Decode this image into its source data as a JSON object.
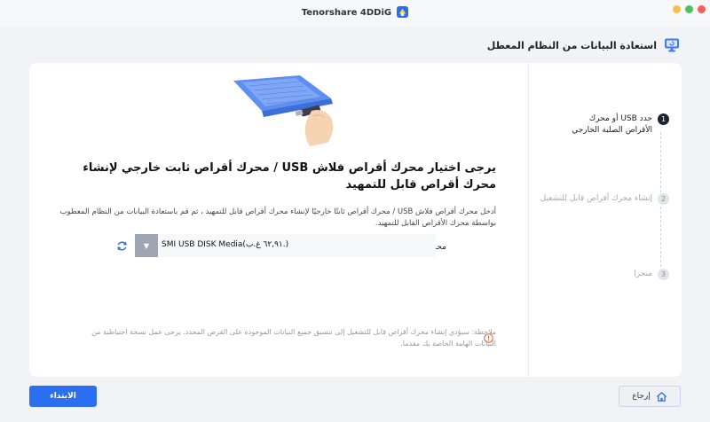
{
  "window": {
    "app_title": "Tenorshare 4DDiG"
  },
  "page": {
    "title": "استعادة البيانات من النظام المعطل"
  },
  "steps": [
    {
      "number": "1",
      "label": "حدد USB أو محرك الأقراص الصلبة الخارجي",
      "state": "active"
    },
    {
      "number": "2",
      "label": "إنشاء محرك أقراص قابل للتشغيل",
      "state": "inactive"
    },
    {
      "number": "3",
      "label": "منجزا",
      "state": "inactive"
    }
  ],
  "main": {
    "heading": "يرجى اختيار محرك أقراص فلاش USB / محرك أقراص ثابت خارجي لإنشاء محرك أقراص قابل للتمهيد",
    "description": "أدخل محرك أقراص فلاش USB / محرك أقراص ثابتًا خارجيًا لإنشاء محرك أقراص قابل للتمهيد ، ثم قم باستعادة البيانات من النظام المعطوب بواسطة محرك الأقراص القابل للتمهيد.",
    "drive_label": "محرك للتمهيد:",
    "drive_value": "SMI USB DISK Media(٦٢,٩١ غ.ب.)",
    "note": "ملاحظة: سيؤدي إنشاء محرك أقراص قابل للتشغيل إلى تنسيق جميع البيانات الموجودة على القرص المحدد. يرجى عمل نسخة احتياطية من البيانات الهامة الخاصة بك مقدما."
  },
  "buttons": {
    "start": "الابتداء",
    "back": "إرجاع"
  },
  "colors": {
    "primary": "#2a6ff2",
    "step_active": "#1c2434",
    "warning": "#e05a3a"
  },
  "icons": {
    "logo": "4ddig-logo-icon",
    "monitor": "monitor-icon",
    "refresh": "refresh-icon",
    "warning": "warning-icon",
    "home": "home-icon",
    "dropdown": "chevron-down-icon"
  }
}
